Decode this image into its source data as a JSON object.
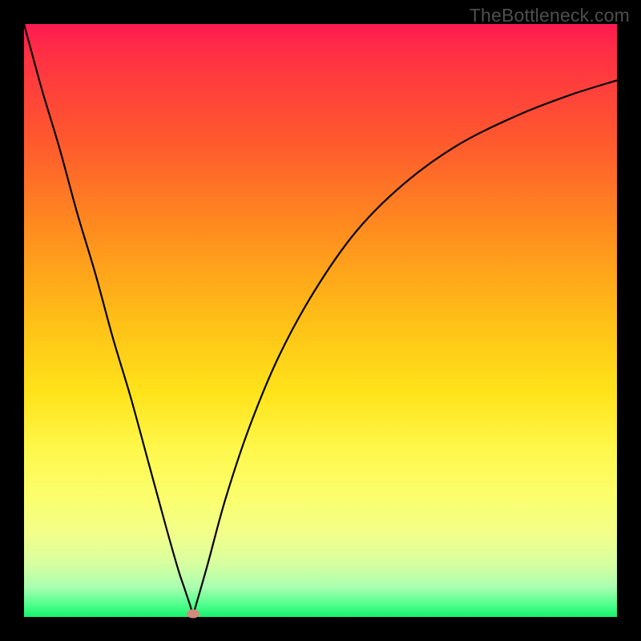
{
  "watermark": "TheBottleneck.com",
  "chart_data": {
    "type": "line",
    "title": "",
    "xlabel": "",
    "ylabel": "",
    "xlim": [
      0,
      100
    ],
    "ylim": [
      0,
      100
    ],
    "grid": false,
    "legend": false,
    "min_point": {
      "x": 28.5,
      "y": 0.5
    },
    "series": [
      {
        "name": "curve",
        "color": "#000000",
        "x": [
          0,
          3,
          6,
          9,
          12,
          15,
          18,
          21,
          24,
          26,
          27,
          28,
          28.5,
          29,
          31,
          34,
          38,
          43,
          49,
          56,
          64,
          73,
          83,
          92,
          100
        ],
        "y": [
          100,
          89,
          79,
          68,
          58,
          47,
          37,
          26,
          15,
          8,
          5,
          2,
          0.5,
          2,
          9,
          20,
          32,
          44,
          55,
          65,
          73,
          79.5,
          84.5,
          88,
          90.5
        ]
      }
    ],
    "gradient_stops": [
      {
        "pos": 0,
        "color": "#ff1a52"
      },
      {
        "pos": 5,
        "color": "#ff3044"
      },
      {
        "pos": 20,
        "color": "#ff5a2e"
      },
      {
        "pos": 35,
        "color": "#ff8e1e"
      },
      {
        "pos": 50,
        "color": "#ffbf17"
      },
      {
        "pos": 62,
        "color": "#ffe31a"
      },
      {
        "pos": 72,
        "color": "#fff84d"
      },
      {
        "pos": 80,
        "color": "#fbff6e"
      },
      {
        "pos": 86,
        "color": "#f2ff8a"
      },
      {
        "pos": 91,
        "color": "#d8ffa0"
      },
      {
        "pos": 95,
        "color": "#a8ffb0"
      },
      {
        "pos": 98,
        "color": "#4eff8c"
      },
      {
        "pos": 100,
        "color": "#15f36b"
      }
    ]
  }
}
